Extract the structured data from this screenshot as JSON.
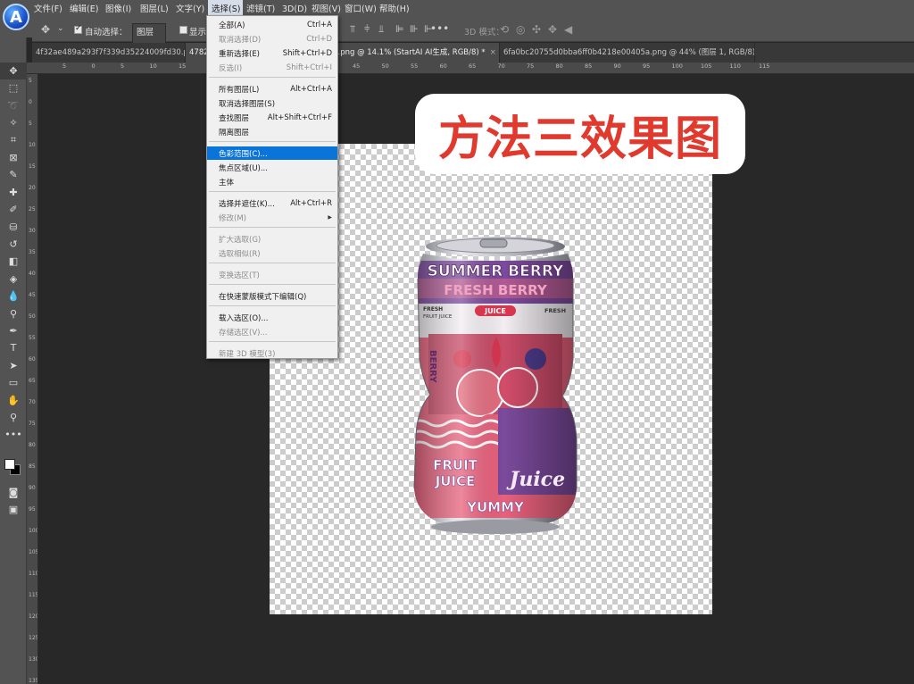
{
  "menubar": {
    "items": [
      "文件(F)",
      "编辑(E)",
      "图像(I)",
      "图层(L)",
      "文字(Y)",
      "选择(S)",
      "滤镜(T)",
      "3D(D)",
      "视图(V)",
      "窗口(W)",
      "帮助(H)"
    ],
    "active_index": 5
  },
  "logo": {
    "letter": "A"
  },
  "options": {
    "auto_select_label": "自动选择：",
    "auto_select_value": "图层",
    "show_label": "显示",
    "mode_3d_label": "3D 模式："
  },
  "tabs": [
    {
      "label": "4f32ae489a293f7f339d35224009fd30.png @ 2"
    },
    {
      "label": "478258e93e2e97abf1d3f4dd11c05a5b.png @ 14.1% (StartAI AI生成, RGB/8) *"
    },
    {
      "label": "6fa0bc20755d0bba6ff0b4218e00405a.png @ 44% (图层 1, RGB/8) *"
    }
  ],
  "ruler": {
    "h_ticks": [
      "5",
      "0",
      "5",
      "10",
      "15",
      "20",
      "25",
      "30",
      "35",
      "40",
      "45",
      "50",
      "55",
      "60",
      "65",
      "70",
      "75",
      "80",
      "85",
      "90",
      "95",
      "100",
      "105",
      "110",
      "115"
    ],
    "v_ticks": [
      "5",
      "0",
      "5",
      "10",
      "15",
      "20",
      "25",
      "30",
      "35",
      "40",
      "45",
      "50",
      "55",
      "60",
      "65",
      "70",
      "75",
      "80",
      "85",
      "90",
      "95",
      "100",
      "105",
      "110",
      "115",
      "120",
      "125",
      "130",
      "135"
    ]
  },
  "select_menu": {
    "items": [
      {
        "label": "全部(A)",
        "shortcut": "Ctrl+A",
        "disabled": false
      },
      {
        "label": "取消选择(D)",
        "shortcut": "Ctrl+D",
        "disabled": true
      },
      {
        "label": "重新选择(E)",
        "shortcut": "Shift+Ctrl+D",
        "disabled": false
      },
      {
        "label": "反选(I)",
        "shortcut": "Shift+Ctrl+I",
        "disabled": true
      },
      {
        "label": "所有图层(L)",
        "shortcut": "Alt+Ctrl+A",
        "disabled": false
      },
      {
        "label": "取消选择图层(S)",
        "shortcut": "",
        "disabled": false
      },
      {
        "label": "查找图层",
        "shortcut": "Alt+Shift+Ctrl+F",
        "disabled": false
      },
      {
        "label": "隔离图层",
        "shortcut": "",
        "disabled": false
      },
      {
        "label": "色彩范围(C)...",
        "shortcut": "",
        "disabled": false,
        "highlighted": true
      },
      {
        "label": "焦点区域(U)...",
        "shortcut": "",
        "disabled": false
      },
      {
        "label": "主体",
        "shortcut": "",
        "disabled": false
      },
      {
        "label": "选择并遮住(K)...",
        "shortcut": "Alt+Ctrl+R",
        "disabled": false
      },
      {
        "label": "修改(M)",
        "shortcut": "",
        "disabled": true,
        "submenu": true
      },
      {
        "label": "扩大选取(G)",
        "shortcut": "",
        "disabled": true
      },
      {
        "label": "选取相似(R)",
        "shortcut": "",
        "disabled": true
      },
      {
        "label": "变换选区(T)",
        "shortcut": "",
        "disabled": true
      },
      {
        "label": "在快速蒙版模式下编辑(Q)",
        "shortcut": "",
        "disabled": false
      },
      {
        "label": "载入选区(O)...",
        "shortcut": "",
        "disabled": false
      },
      {
        "label": "存储选区(V)...",
        "shortcut": "",
        "disabled": true
      },
      {
        "label": "新建 3D 模型(3)",
        "shortcut": "",
        "disabled": true
      }
    ]
  },
  "caption": {
    "text": "方法三效果图"
  },
  "can": {
    "line1": "SUMMER BERRY",
    "line2": "FRESH BERRY",
    "juice_badge": "JUICE",
    "fresh_left": "FRESH",
    "fruit_juice_small": "FRUIT JUICE",
    "fresh_right": "FRESH",
    "berry_side": "BERRY",
    "fruit": "FRUIT",
    "juice_big": "JUICE",
    "juice_script": "Juice",
    "yummy": "YUMMY",
    "colors": {
      "pink": "#e8617c",
      "purple": "#7b4a9c",
      "silver": "#c9c9cf"
    }
  },
  "colors": {
    "accent": "#0b74d8",
    "caption_red": "#e03a2f",
    "menubar": "#535353",
    "canvas_bg": "#282828"
  }
}
